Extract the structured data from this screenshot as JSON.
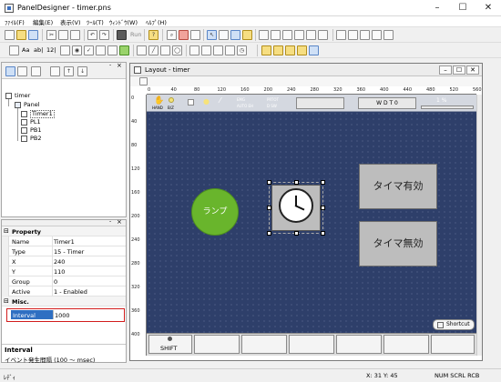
{
  "window": {
    "title": "PanelDesigner - timer.pns",
    "minimize": "–",
    "maximize": "☐",
    "close": "✕"
  },
  "menu": [
    "ﾌｧｲﾙ(F)",
    "編集(E)",
    "表示(V)",
    "ﾂｰﾙ(T)",
    "ｳｨﾝﾄﾞｳ(W)",
    "ﾍﾙﾌﾟ(H)"
  ],
  "toolbar1": {
    "run_label": "Run"
  },
  "toolbar2": {
    "text_tools": [
      "Aa",
      "ab|",
      "12|"
    ]
  },
  "tree": {
    "root": "timer",
    "panel": "Panel",
    "items": [
      "Timer1",
      "PL1",
      "PB1",
      "PB2"
    ],
    "selected": "Timer1"
  },
  "tree_panel": {
    "close": "×",
    "pin": "-"
  },
  "properties": {
    "header": "Property",
    "rows": [
      {
        "name": "Name",
        "value": "Timer1"
      },
      {
        "name": "Type",
        "value": "15 - Timer"
      },
      {
        "name": "X",
        "value": "240"
      },
      {
        "name": "Y",
        "value": "110"
      },
      {
        "name": "Group",
        "value": "0"
      },
      {
        "name": "Active",
        "value": "1 - Enabled"
      }
    ],
    "misc_header": "Misc.",
    "interval": {
      "name": "Interval",
      "value": "1000"
    }
  },
  "help": {
    "title": "Interval",
    "desc": "イベント発生間隔 (100 ～ msec)"
  },
  "layout": {
    "title": "Layout - timer",
    "ruler_h": [
      "0",
      "40",
      "80",
      "120",
      "160",
      "200",
      "240",
      "280",
      "320",
      "360",
      "400",
      "440",
      "480",
      "520",
      "560"
    ],
    "ruler_v": [
      "0",
      "40",
      "80",
      "120",
      "160",
      "200",
      "240",
      "280",
      "320",
      "360",
      "400"
    ],
    "indicators": {
      "hand": "HAND",
      "bz": "B/Z",
      "emg": "EMG",
      "prtot": "PRTOT",
      "auto_eh": "AUTO EH",
      "d_sw": "D SW"
    },
    "wdt": "W D T 0",
    "percent": "1  %",
    "lamp": "ランプ",
    "timer_on": "タイマ有効",
    "timer_off": "タイマ無効",
    "shortcut": "Shortcut",
    "shift": "SHIFT"
  },
  "status": {
    "ready": "ﾚﾃﾞｨ",
    "coords": "X:  31 Y:  45",
    "indicators": "NUM  SCRL  RCB"
  }
}
